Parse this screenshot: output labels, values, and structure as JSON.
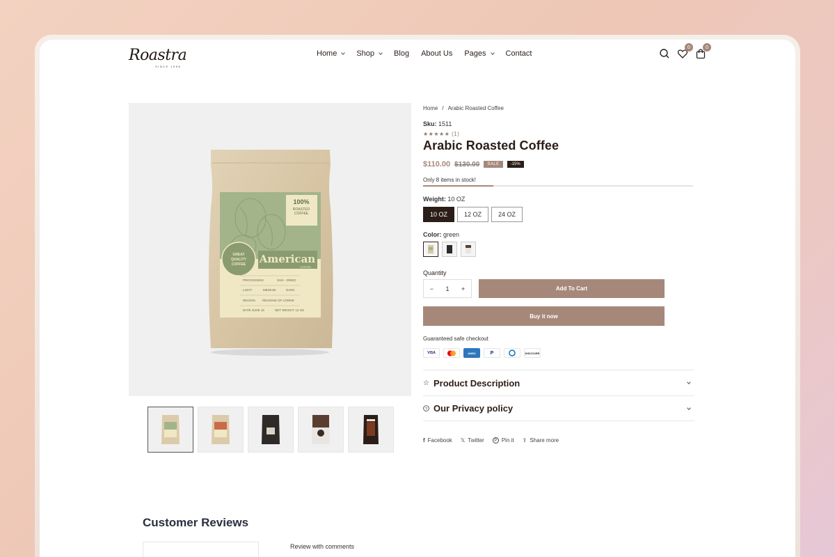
{
  "brand": {
    "name": "Roastra",
    "tagline": "SINCE 1998"
  },
  "nav": {
    "items": [
      {
        "label": "Home",
        "dropdown": true
      },
      {
        "label": "Shop",
        "dropdown": true
      },
      {
        "label": "Blog",
        "dropdown": false
      },
      {
        "label": "About Us",
        "dropdown": false
      },
      {
        "label": "Pages",
        "dropdown": true
      },
      {
        "label": "Contact",
        "dropdown": false
      }
    ]
  },
  "header": {
    "wishlist_count": "0",
    "cart_count": "0"
  },
  "breadcrumb": {
    "home": "Home",
    "separator": "/",
    "current": "Arabic Roasted Coffee"
  },
  "product": {
    "sku_label": "Sku:",
    "sku": "1511",
    "rating_stars": "★★★★★",
    "rating_count": "(1)",
    "title": "Arabic Roasted Coffee",
    "price": "$110.00",
    "old_price": "$130.00",
    "sale_badge": "SALE",
    "discount_badge": "-15%",
    "stock_text": "Only 8 items in stock!",
    "stock_fraction": 0.26,
    "weight_label": "Weight:",
    "weight_selected": "10 OZ",
    "weights": [
      "10 OZ",
      "12 OZ",
      "24 OZ"
    ],
    "color_label": "Color:",
    "color_selected": "green",
    "quantity_label": "Quantity",
    "quantity": "1",
    "add_to_cart": "Add To Cart",
    "buy_now": "Buy it now",
    "guarantee": "Guaranteed safe checkout",
    "payments": [
      "VISA",
      "mastercard-icon",
      "AMEX",
      "paypal-icon",
      "diners-icon",
      "DISCOVER"
    ],
    "accordions": [
      "Product Description",
      "Our Privacy policy"
    ],
    "share": [
      "Facebook",
      "Twitter",
      "Pin it",
      "Share more"
    ]
  },
  "package": {
    "badge_top": "100%",
    "badge_line2": "ROASTED",
    "badge_line3": "COFFEE",
    "seal_line1": "GREAT",
    "seal_line2": "QUALITY",
    "seal_line3": "COFFEE",
    "name": "American",
    "name_sub": "COFFEE",
    "table": [
      [
        "PROCESSING",
        "SUN - DRIED"
      ],
      [
        "LIGHT",
        "MEDIUM",
        "DARK"
      ],
      [
        "REGION",
        "REGIONS OF LOREM"
      ],
      [
        "DATE JUNE 16",
        "NET WEIGHT 12 OZ"
      ]
    ]
  },
  "reviews": {
    "title": "Customer Reviews",
    "with_comments": "Review with comments"
  },
  "colors": {
    "accent": "#a6887a",
    "dark": "#2b1d17",
    "green": "#a3b48b"
  }
}
